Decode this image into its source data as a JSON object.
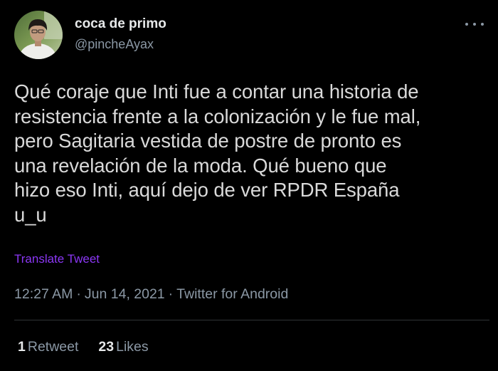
{
  "tweet": {
    "display_name": "coca de primo",
    "handle": "@pincheAyax",
    "text": "Qué coraje que Inti fue a contar una historia de\nresistencia frente a la colonización y le fue mal,\npero Sagitaria vestida de postre de pronto es\nuna revelación de la moda. Qué bueno que\nhizo eso Inti, aquí dejo de ver RPDR España\nu_u",
    "translate_label": "Translate Tweet",
    "time": "12:27 AM",
    "date": "Jun 14, 2021",
    "source": "Twitter for Android",
    "separator": "·",
    "retweets": {
      "count": "1",
      "label": "Retweet"
    },
    "likes": {
      "count": "23",
      "label": "Likes"
    }
  },
  "icons": {
    "more": "more-horizontal-icon",
    "avatar": "profile-photo"
  },
  "colors": {
    "background": "#000000",
    "text": "#d9d9d9",
    "secondary": "#8b98a5",
    "translate_link": "#8b37f5",
    "divider": "#2f3336"
  }
}
